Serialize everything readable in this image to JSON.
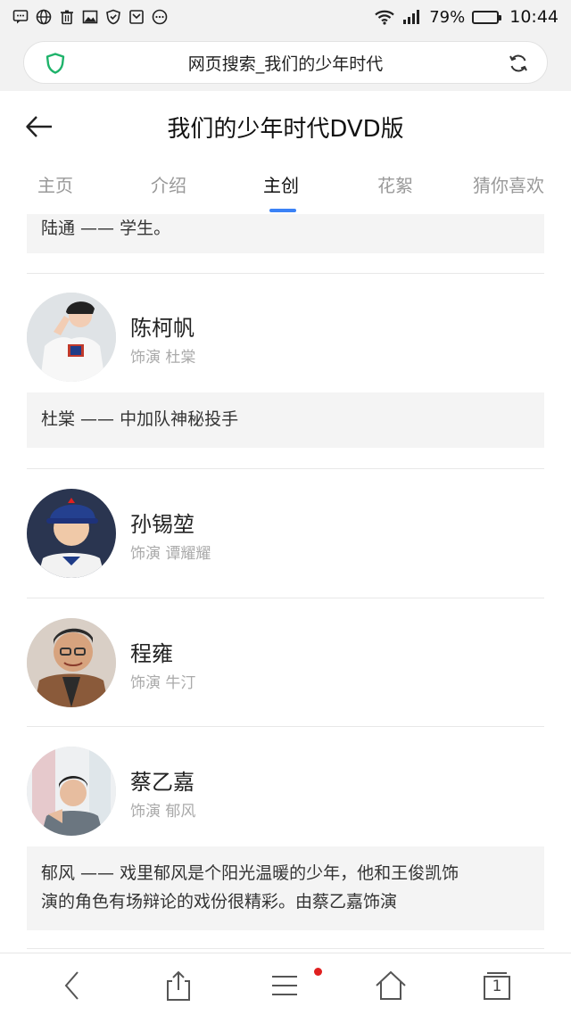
{
  "status": {
    "battery": "79%",
    "time": "10:44",
    "battery_level": 0.79
  },
  "url_bar": {
    "text": "网页搜索_我们的少年时代"
  },
  "header": {
    "title": "我们的少年时代DVD版"
  },
  "tabs": [
    {
      "label": "主页"
    },
    {
      "label": "介绍"
    },
    {
      "label": "主创"
    },
    {
      "label": "花絮"
    },
    {
      "label": "猜你喜欢"
    }
  ],
  "active_tab": "主创",
  "roles": {
    "top_partial": "陆通 —— 学生。",
    "chen_kefan_role": "杜棠 —— 中加队神秘投手",
    "cai_yijia_role_line1": "郁风 —— 戏里郁风是个阳光温暖的少年，他和王俊凯饰",
    "cai_yijia_role_line2": "演的角色有场辩论的戏份很精彩。由蔡乙嘉饰演"
  },
  "cast": [
    {
      "name": "陈柯帆",
      "role": "饰演 杜棠"
    },
    {
      "name": "孙锡堃",
      "role": "饰演 谭耀耀"
    },
    {
      "name": "程雍",
      "role": "饰演 牛汀"
    },
    {
      "name": "蔡乙嘉",
      "role": "饰演 郁风"
    }
  ],
  "bottom_nav": {
    "tab_count": "1"
  },
  "colors": {
    "accent": "#3b82f6",
    "shield": "#1fb36b",
    "notification": "#e02020",
    "battery": "#35c12d"
  }
}
